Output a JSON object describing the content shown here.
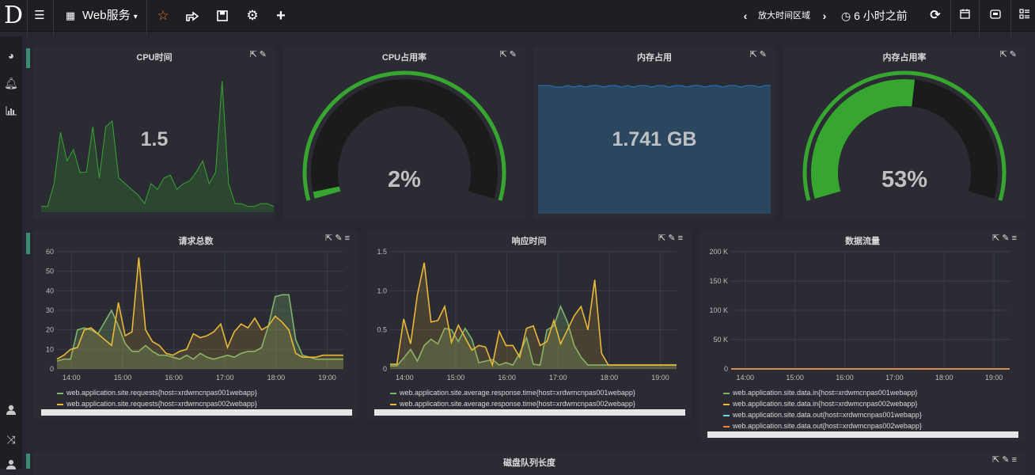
{
  "topbar": {
    "logo": "D",
    "dashboard_title": "Web服务",
    "zoom_label": "放大时间区域",
    "time_range": "6 小时之前"
  },
  "colors": {
    "green": "#7eb26d",
    "yellow": "#eab839",
    "cyan": "#6ed0e0",
    "orange": "#ef843c",
    "gauge_green": "#37a630",
    "mem_fill": "#2b4760"
  },
  "singlestats": [
    {
      "title": "CPU时间",
      "value": "1.5"
    },
    {
      "title": "CPU占用率",
      "value": "2%",
      "gauge_fraction": 0.02
    },
    {
      "title": "内存占用",
      "value": "1.741 GB"
    },
    {
      "title": "内存占用率",
      "value": "53%",
      "gauge_fraction": 0.53
    }
  ],
  "graphs": [
    {
      "title": "请求总数",
      "y_ticks": [
        "60",
        "50",
        "40",
        "30",
        "20",
        "10",
        "0"
      ],
      "x_ticks": [
        "14:00",
        "15:00",
        "16:00",
        "17:00",
        "18:00",
        "19:00"
      ],
      "legend": [
        "web.application.site.requests{host=xrdwmcnpas001webapp}",
        "web.application.site.requests{host=xrdwmcnpas002webapp}"
      ]
    },
    {
      "title": "响应时间",
      "y_ticks": [
        "1.5",
        "1.0",
        "0.5",
        "0"
      ],
      "x_ticks": [
        "14:00",
        "15:00",
        "16:00",
        "17:00",
        "18:00",
        "19:00"
      ],
      "legend": [
        "web.application.site.average.response.time{host=xrdwmcnpas001webapp}",
        "web.application.site.average.response.time{host=xrdwmcnpas002webapp}"
      ]
    },
    {
      "title": "数据流量",
      "y_ticks": [
        "200 K",
        "150 K",
        "100 K",
        "50 K",
        "0"
      ],
      "x_ticks": [
        "14:00",
        "15:00",
        "16:00",
        "17:00",
        "18:00",
        "19:00"
      ],
      "legend": [
        "web.application.site.data.in{host=xrdwmcnpas001webapp}",
        "web.application.site.data.in{host=xrdwmcnpas002webapp}",
        "web.application.site.data.out{host=xrdwmcnpas001webapp}",
        "web.application.site.data.out{host=xrdwmcnpas002webapp}"
      ]
    }
  ],
  "bottom_panel": {
    "title": "磁盘队列长度"
  },
  "chart_data": [
    {
      "type": "area",
      "series": [
        {
          "values": [
            2,
            2,
            10,
            28,
            18,
            22,
            14,
            14,
            30,
            12,
            30,
            32,
            12,
            10,
            8,
            6,
            3,
            10,
            8,
            12,
            13,
            8,
            10,
            11,
            14,
            18,
            10,
            14,
            46,
            10,
            3,
            3,
            2,
            2,
            3,
            3,
            2
          ]
        }
      ]
    },
    {
      "type": "area",
      "series": [
        {
          "values": [
            40,
            40,
            40,
            39,
            39,
            40,
            39,
            40,
            39,
            40,
            40,
            39,
            40,
            40,
            39,
            40,
            39,
            40,
            40,
            39,
            40,
            40,
            39,
            40,
            40,
            39,
            40,
            40,
            39,
            40,
            40,
            39,
            40,
            40,
            39,
            40,
            40,
            39,
            40,
            40
          ]
        }
      ]
    },
    {
      "type": "line",
      "x": [
        "13:43",
        "13:51",
        "13:59",
        "14:07",
        "14:15",
        "14:23",
        "14:31",
        "14:39",
        "14:47",
        "14:55",
        "15:03",
        "15:11",
        "15:19",
        "15:27",
        "15:35",
        "15:43",
        "15:51",
        "15:59",
        "16:07",
        "16:15",
        "16:23",
        "16:31",
        "16:39",
        "16:47",
        "16:55",
        "17:03",
        "17:11",
        "17:19",
        "17:27",
        "17:35",
        "17:43",
        "17:51",
        "17:59",
        "18:07",
        "18:15",
        "18:23",
        "18:31",
        "18:39",
        "18:47",
        "18:55",
        "19:03",
        "19:11",
        "19:19"
      ],
      "series": [
        {
          "name": "web.application.site.requests{host=xrdwmcnpas001webapp}",
          "values": [
            4,
            5,
            5,
            20,
            21,
            20,
            18,
            24,
            30,
            22,
            13,
            9,
            9,
            12,
            9,
            7,
            7,
            6,
            5,
            7,
            5,
            8,
            6,
            5,
            6,
            7,
            6,
            8,
            9,
            9,
            11,
            22,
            37,
            38,
            38,
            15,
            7,
            6,
            5,
            5,
            5,
            5,
            5
          ]
        },
        {
          "name": "web.application.site.requests{host=xrdwmcnpas002webapp}",
          "values": [
            5,
            7,
            10,
            11,
            20,
            21,
            18,
            15,
            12,
            34,
            17,
            19,
            57,
            20,
            14,
            12,
            8,
            7,
            9,
            10,
            18,
            16,
            17,
            19,
            23,
            11,
            19,
            23,
            21,
            26,
            20,
            22,
            27,
            24,
            20,
            8,
            6,
            6,
            6,
            7,
            7,
            7,
            7
          ]
        }
      ],
      "ylim": [
        0,
        60
      ]
    },
    {
      "type": "line",
      "x": [
        "13:43",
        "13:51",
        "13:59",
        "14:07",
        "14:15",
        "14:23",
        "14:31",
        "14:39",
        "14:47",
        "14:55",
        "15:03",
        "15:11",
        "15:19",
        "15:27",
        "15:35",
        "15:43",
        "15:51",
        "15:59",
        "16:07",
        "16:15",
        "16:23",
        "16:31",
        "16:39",
        "16:47",
        "16:55",
        "17:03",
        "17:11",
        "17:19",
        "17:27",
        "17:35",
        "17:43",
        "17:51",
        "17:59",
        "18:07",
        "18:15",
        "18:23",
        "18:31",
        "18:39",
        "18:47",
        "18:55",
        "19:03",
        "19:11",
        "19:19"
      ],
      "series": [
        {
          "name": "web.application.site.average.response.time{host=xrdwmcnpas001webapp}",
          "values": [
            0.04,
            0.04,
            0.14,
            0.25,
            0.1,
            0.3,
            0.38,
            0.32,
            0.52,
            0.5,
            0.35,
            0.52,
            0.38,
            0.08,
            0.1,
            0.12,
            0.05,
            0.08,
            0.05,
            0.2,
            0.4,
            0.06,
            0.05,
            0.5,
            0.55,
            0.8,
            0.6,
            0.3,
            0.15,
            0.05,
            0.05,
            0.05,
            0.05,
            0.05,
            0.05,
            0.05,
            0.05,
            0.05,
            0.05,
            0.05,
            0.05,
            0.05,
            0.05
          ]
        },
        {
          "name": "web.application.site.average.response.time{host=xrdwmcnpas002webapp}",
          "values": [
            0.06,
            0.06,
            0.64,
            0.32,
            0.95,
            1.36,
            0.6,
            0.62,
            0.8,
            0.34,
            0.56,
            0.4,
            0.24,
            0.3,
            0.28,
            0.05,
            0.48,
            0.3,
            0.3,
            0.15,
            0.52,
            0.55,
            0.3,
            0.35,
            0.62,
            0.32,
            0.5,
            0.68,
            0.8,
            0.5,
            1.14,
            0.2,
            0.05,
            0.05,
            0.05,
            0.05,
            0.05,
            0.05,
            0.05,
            0.05,
            0.05,
            0.05,
            0.05
          ]
        }
      ],
      "ylim": [
        0,
        1.5
      ]
    },
    {
      "type": "line",
      "x": [
        "13:43",
        "13:51",
        "13:59",
        "14:07",
        "14:15",
        "14:23",
        "14:31",
        "14:39",
        "14:47",
        "14:55",
        "15:03",
        "15:11",
        "15:19",
        "15:27",
        "15:35",
        "15:43",
        "15:51",
        "15:59",
        "16:07",
        "16:15",
        "16:23",
        "16:31",
        "16:39",
        "16:47",
        "16:55",
        "17:03",
        "17:11",
        "17:19",
        "17:27",
        "17:35",
        "17:43",
        "17:51",
        "17:59",
        "18:07",
        "18:15",
        "18:23",
        "18:31",
        "18:39",
        "18:47",
        "18:55",
        "19:03",
        "19:11",
        "19:19"
      ],
      "series": [
        {
          "name": "web.application.site.data.in{host=xrdwmcnpas001webapp}",
          "values": [
            3,
            3,
            8,
            20,
            28,
            30,
            40,
            48,
            38,
            15,
            15,
            35,
            30,
            15,
            12,
            10,
            8,
            4,
            5,
            8,
            6,
            6,
            5,
            8,
            5,
            4,
            8,
            8,
            10,
            6,
            10,
            28,
            45,
            30,
            14,
            10,
            6,
            5,
            5,
            5,
            5,
            4,
            4
          ]
        },
        {
          "name": "web.application.site.data.in{host=xrdwmcnpas002webapp}",
          "values": [
            2,
            3,
            10,
            18,
            35,
            40,
            30,
            80,
            30,
            30,
            30,
            52,
            80,
            150,
            30,
            25,
            20,
            10,
            6,
            15,
            18,
            8,
            22,
            20,
            18,
            25,
            60,
            28,
            20,
            30,
            50,
            65,
            80,
            20,
            55,
            40,
            5,
            4,
            4,
            4,
            4,
            4,
            4
          ]
        },
        {
          "name": "web.application.site.data.out{host=xrdwmcnpas001webapp}",
          "values": [
            25,
            27,
            26,
            30,
            40,
            65,
            45,
            45,
            120,
            40,
            35,
            48,
            78,
            38,
            28,
            32,
            28,
            25,
            28,
            26,
            25,
            27,
            30,
            24,
            26,
            28,
            24,
            26,
            26,
            30,
            35,
            44,
            50,
            50,
            45,
            30,
            27,
            28,
            27,
            25,
            24,
            24,
            22
          ]
        },
        {
          "name": "web.application.site.data.out{host=xrdwmcnpas002webapp}",
          "values": [
            5,
            5,
            12,
            20,
            50,
            38,
            30,
            60,
            30,
            25,
            28,
            45,
            75,
            155,
            45,
            40,
            30,
            25,
            15,
            22,
            35,
            12,
            40,
            30,
            28,
            72,
            40,
            15,
            55,
            70,
            85,
            40,
            55,
            30,
            100,
            45,
            6,
            5,
            5,
            5,
            5,
            5,
            5
          ]
        }
      ],
      "ylim": [
        0,
        200000
      ]
    }
  ]
}
